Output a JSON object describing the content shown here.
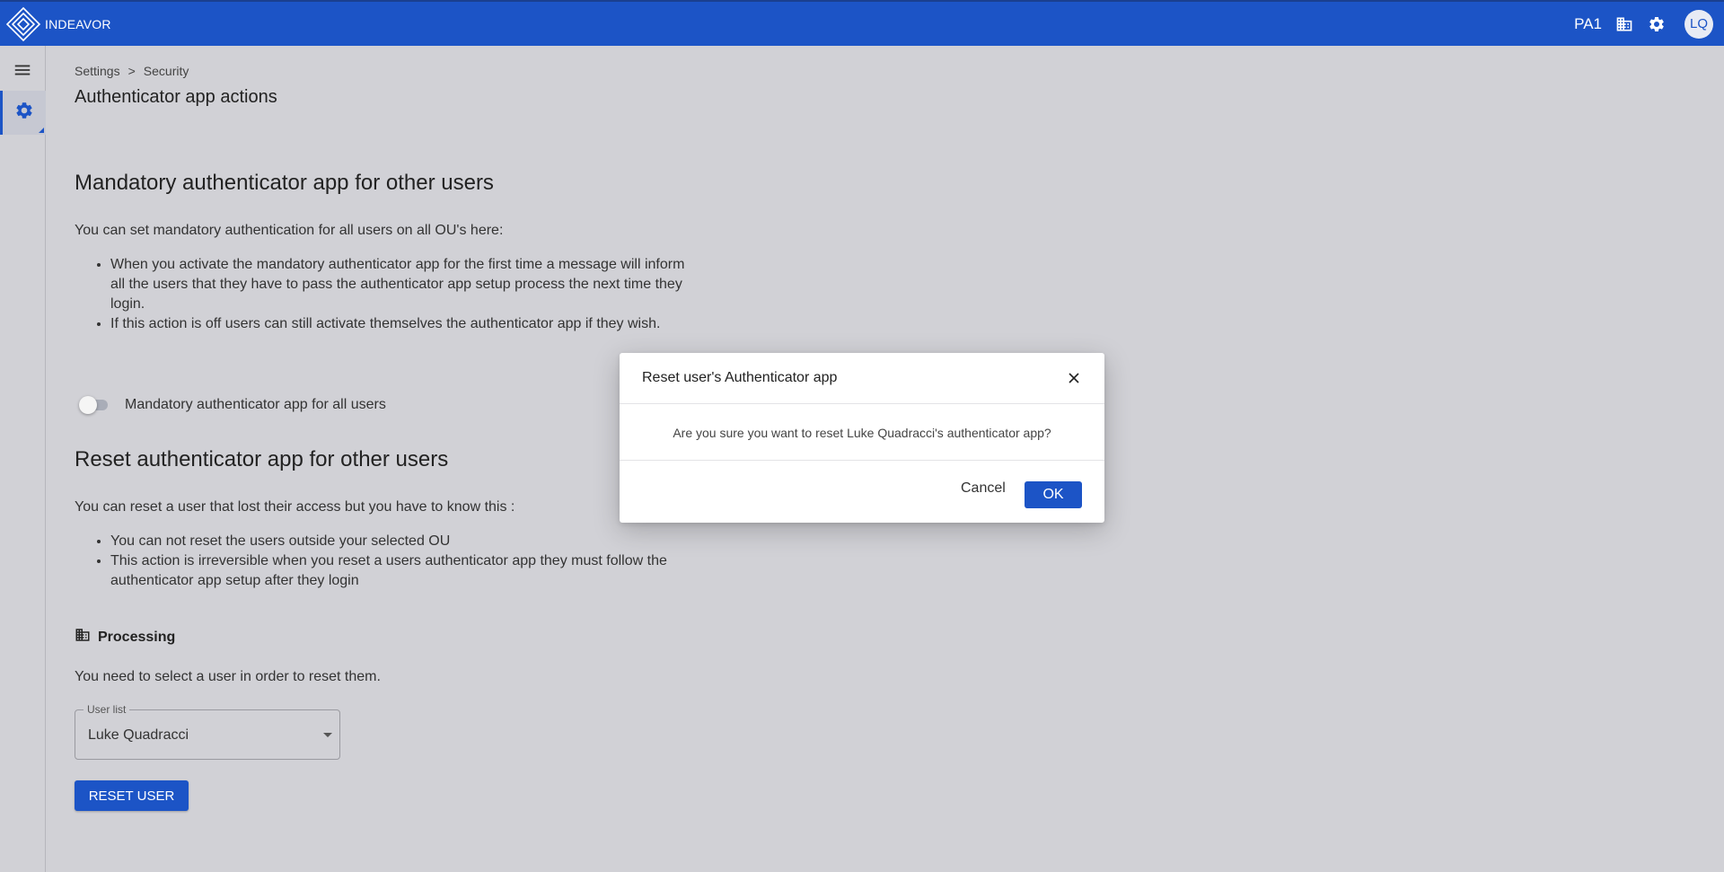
{
  "app": {
    "name": "INDEAVOR"
  },
  "topbar": {
    "ou_code": "PA1",
    "avatar_initials": "LQ",
    "icons": [
      "building-icon",
      "gear-icon"
    ]
  },
  "sidebar": {
    "items": [
      {
        "icon": "menu-icon"
      },
      {
        "icon": "gear-icon",
        "active": true
      }
    ]
  },
  "breadcrumb": {
    "items": [
      "Settings",
      "Security"
    ],
    "separator": ">"
  },
  "page_title": "Authenticator app actions",
  "mandatory": {
    "heading": "Mandatory authenticator app for other users",
    "intro": "You can set mandatory authentication for all users on all OU's here:",
    "bullets": [
      "When you activate the mandatory authenticator app for the first time a message will inform all the users that they have to pass the authenticator app setup process the next time they login.",
      "If this action is off users can still activate themselves the authenticator app if they wish."
    ],
    "toggle_label": "Mandatory authenticator app for all users",
    "toggle_on": false
  },
  "reset": {
    "heading": "Reset authenticator app for other users",
    "intro": "You can reset a user that lost their access but you have to know this :",
    "bullets": [
      "You can not reset the users outside your selected OU",
      "This action is irreversible when you reset a users authenticator app they must follow the authenticator app setup after they login"
    ],
    "ou_name": "Processing",
    "select_hint": "You need to select a user in order to reset them.",
    "user_list_label": "User list",
    "user_list_value": "Luke Quadracci",
    "reset_button": "RESET USER"
  },
  "dialog": {
    "title": "Reset user's Authenticator app",
    "message": "Are you sure you want to reset Luke Quadracci's authenticator app?",
    "cancel_label": "Cancel",
    "ok_label": "OK"
  },
  "colors": {
    "primary": "#1c54c6",
    "background": "#d1d1d6"
  }
}
